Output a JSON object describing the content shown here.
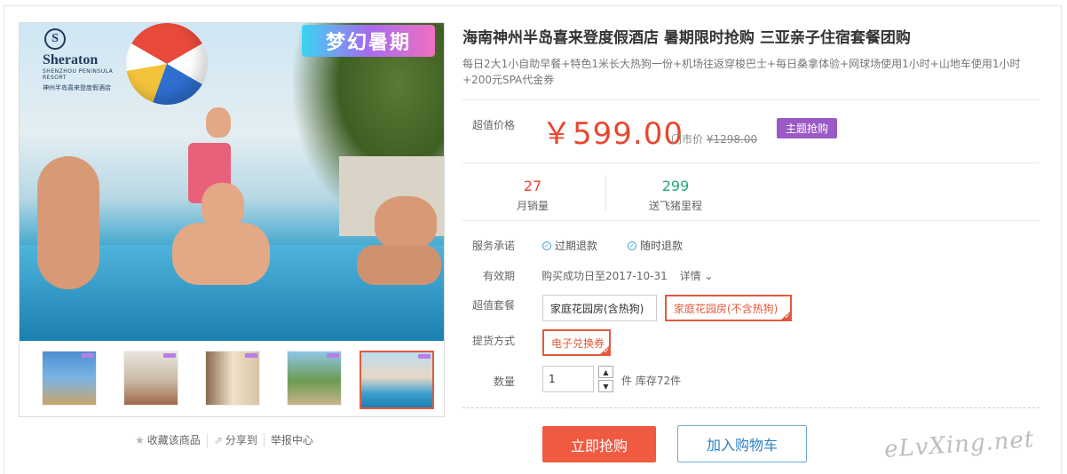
{
  "gallery": {
    "badge": "梦幻暑期",
    "logo": {
      "emblem": "S",
      "name": "Sheraton",
      "sub1": "SHENZHOU PENINSULA",
      "sub2": "RESORT",
      "cn": "神州半岛喜来登度假酒店"
    },
    "thumbnails": [
      {
        "name": "thumb-1"
      },
      {
        "name": "thumb-2"
      },
      {
        "name": "thumb-3"
      },
      {
        "name": "thumb-4"
      },
      {
        "name": "thumb-5"
      }
    ],
    "active_thumbnail": 5,
    "actions": {
      "favorite": "收藏该商品",
      "share": "分享到",
      "report": "举报中心"
    }
  },
  "product": {
    "title": "海南神州半岛喜来登度假酒店 暑期限时抢购 三亚亲子住宿套餐团购",
    "subtitle": "每日2大1小自助早餐+特色1米长大热狗一份+机场往返穿梭巴士+每日桑拿体验+网球场使用1小时+山地车使用1小时+200元SPA代金券"
  },
  "pricing": {
    "label": "超值价格",
    "price": "￥599.00",
    "market_label": "门市价",
    "market_price": "¥1298.00",
    "promo_tag": "主题抢购"
  },
  "stats": [
    {
      "value": "27",
      "label": "月销量",
      "color": "#e8472f"
    },
    {
      "value": "299",
      "label": "送飞猪里程",
      "color": "#2aa57c"
    }
  ],
  "service": {
    "label": "服务承诺",
    "items": [
      "过期退款",
      "随时退款"
    ]
  },
  "validity": {
    "label": "有效期",
    "text": "购买成功日至2017-10-31",
    "details": "详情"
  },
  "package": {
    "label": "超值套餐",
    "options": [
      "家庭花园房(含热狗)",
      "家庭花园房(不含热狗)"
    ],
    "selected": 1
  },
  "delivery": {
    "label": "提货方式",
    "options": [
      "电子兑换券"
    ],
    "selected": 0
  },
  "quantity": {
    "label": "数量",
    "value": "1",
    "unit": "件",
    "stock": "库存72件"
  },
  "buttons": {
    "buy": "立即抢购",
    "cart": "加入购物车"
  },
  "watermark": "eLvXing.net",
  "colors": {
    "accent": "#f05a41",
    "promo": "#9a59c7",
    "link": "#2d80c6"
  }
}
